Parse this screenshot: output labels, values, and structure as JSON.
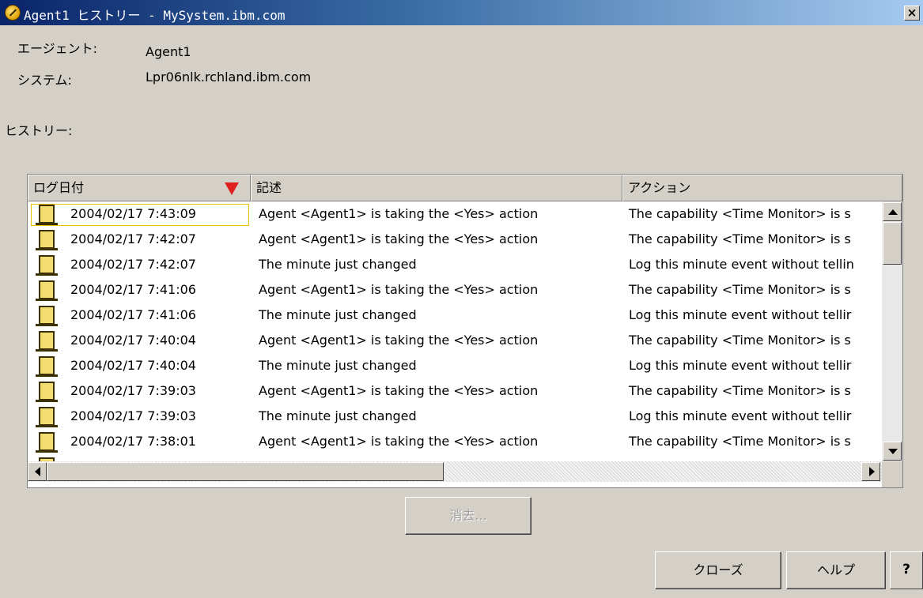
{
  "window": {
    "title": "Agent1 ヒストリー - MySystem.ibm.com",
    "close_glyph": "×"
  },
  "info": {
    "agent_label": "エージェント:",
    "agent_value": "Agent1",
    "system_label": "システム:",
    "system_value": "Lpr06nlk.rchland.ibm.com",
    "history_label": "ヒストリー:"
  },
  "table": {
    "columns": [
      {
        "label": "ログ日付",
        "sorted": "descending"
      },
      {
        "label": "記述"
      },
      {
        "label": "アクション"
      }
    ],
    "row_icon": "log-document-icon",
    "rows": [
      {
        "date": "2004/02/17 7:43:09",
        "description": "Agent <Agent1> is taking the <Yes> action",
        "action": "The capability <Time Monitor> is s"
      },
      {
        "date": "2004/02/17 7:42:07",
        "description": "Agent <Agent1> is taking the <Yes> action",
        "action": "The capability <Time Monitor> is s"
      },
      {
        "date": "2004/02/17 7:42:07",
        "description": "The minute just changed",
        "action": "Log this minute event without tellin"
      },
      {
        "date": "2004/02/17 7:41:06",
        "description": "Agent <Agent1> is taking the <Yes> action",
        "action": "The capability <Time Monitor> is s"
      },
      {
        "date": "2004/02/17 7:41:06",
        "description": "The minute just changed",
        "action": "Log this minute event without tellir"
      },
      {
        "date": "2004/02/17 7:40:04",
        "description": "Agent <Agent1> is taking the <Yes> action",
        "action": "The capability <Time Monitor> is s"
      },
      {
        "date": "2004/02/17 7:40:04",
        "description": "The minute just changed",
        "action": "Log this minute event without tellir"
      },
      {
        "date": "2004/02/17 7:39:03",
        "description": "Agent <Agent1> is taking the <Yes> action",
        "action": "The capability <Time Monitor> is s"
      },
      {
        "date": "2004/02/17 7:39:03",
        "description": "The minute just changed",
        "action": "Log this minute event without tellir"
      },
      {
        "date": "2004/02/17 7:38:01",
        "description": "Agent <Agent1> is taking the <Yes> action",
        "action": "The capability <Time Monitor> is s"
      }
    ]
  },
  "buttons": {
    "delete": "消去...",
    "close": "クローズ",
    "help": "ヘルプ",
    "context_help": "?"
  },
  "colors": {
    "sort_indicator": "#e02020",
    "title_bar_start": "#0a246a",
    "title_bar_end": "#a6caf0",
    "focus_border": "#e8c000"
  }
}
